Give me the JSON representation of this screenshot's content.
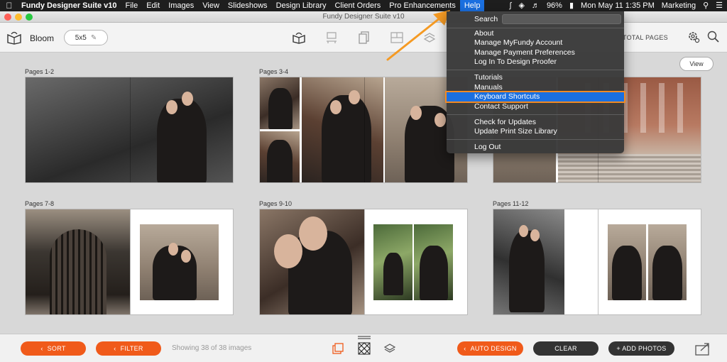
{
  "menubar": {
    "app_name": "Fundy Designer Suite v10",
    "items": [
      "File",
      "Edit",
      "Images",
      "View",
      "Slideshows",
      "Design Library",
      "Client Orders",
      "Pro Enhancements",
      "Help"
    ],
    "battery": "96%",
    "datetime": "Mon May 11  1:35 PM",
    "user": "Marketing"
  },
  "window": {
    "title": "Fundy Designer Suite v10"
  },
  "toolbar": {
    "album_name": "Bloom",
    "size": "5x5",
    "total_pages_label": "TOTAL PAGES"
  },
  "help_menu": {
    "search_label": "Search",
    "groups": [
      [
        "About",
        "Manage MyFundy Account",
        "Manage Payment Preferences",
        "Log In To Design Proofer"
      ],
      [
        "Tutorials",
        "Manuals",
        "Keyboard Shortcuts",
        "Contact Support"
      ],
      [
        "Check for Updates",
        "Update Print Size Library"
      ],
      [
        "Log Out"
      ]
    ],
    "highlighted": "Keyboard Shortcuts"
  },
  "main": {
    "view_label": "View",
    "spreads": [
      {
        "label": "Pages 1-2"
      },
      {
        "label": "Pages 3-4"
      },
      {
        "label": ""
      },
      {
        "label": "Pages 7-8"
      },
      {
        "label": "Pages 9-10"
      },
      {
        "label": "Pages 11-12"
      }
    ]
  },
  "bottombar": {
    "sort_label": "SORT",
    "filter_label": "FILTER",
    "showing_text": "Showing 38 of 38 images",
    "auto_design_label": "AUTO DESIGN",
    "clear_label": "CLEAR",
    "add_photos_label": "+ ADD PHOTOS"
  },
  "colors": {
    "accent_orange": "#f05a1a",
    "menu_highlight": "#1a6fe0",
    "highlight_outline": "#f08a24"
  }
}
